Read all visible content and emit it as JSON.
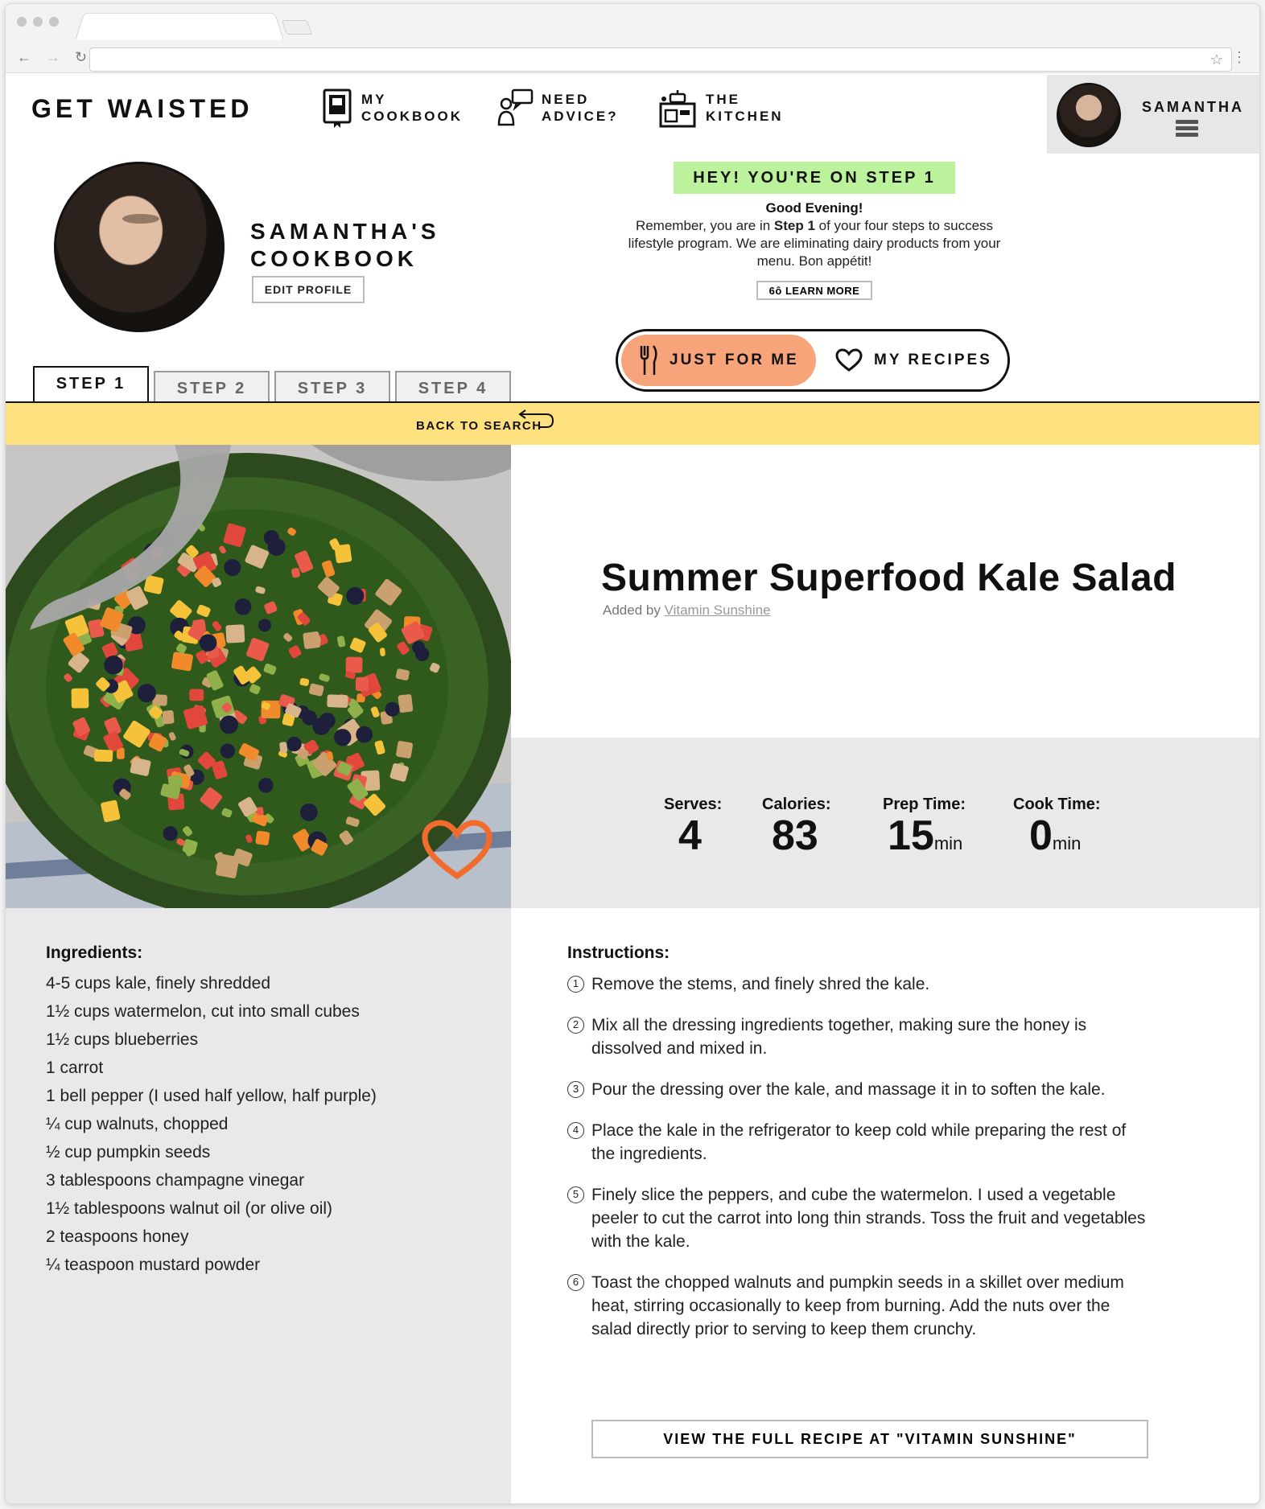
{
  "header": {
    "logo": "GET WAISTED",
    "nav": [
      {
        "line1": "MY",
        "line2": "COOKBOOK",
        "icon": "cookbook-icon"
      },
      {
        "line1": "NEED",
        "line2": "ADVICE?",
        "icon": "advice-icon"
      },
      {
        "line1": "THE",
        "line2": "KITCHEN",
        "icon": "kitchen-icon"
      }
    ],
    "user": {
      "name": "SAMANTHA"
    }
  },
  "profile": {
    "title_line1": "SAMANTHA'S",
    "title_line2": "COOKBOOK",
    "edit_label": "EDIT PROFILE"
  },
  "banner": {
    "step_text": "HEY! YOU'RE ON STEP 1",
    "greeting": "Good Evening!",
    "msg_before": "Remember, you are in ",
    "msg_bold": "Step 1",
    "msg_after": " of your four steps to success lifestyle program. We are eliminating dairy products from your menu. Bon appétit!",
    "learn_more": "LEARN MORE"
  },
  "toggle": {
    "left_label": "JUST FOR ME",
    "right_label": "MY RECIPES"
  },
  "steps": [
    "STEP 1",
    "STEP 2",
    "STEP 3",
    "STEP 4"
  ],
  "back_label": "BACK TO SEARCH",
  "recipe": {
    "title": "Summer Superfood Kale Salad",
    "added_prefix": "Added by ",
    "author": "Vitamin Sunshine",
    "stats": [
      {
        "label": "Serves:",
        "value": "4",
        "unit": ""
      },
      {
        "label": "Calories:",
        "value": "83",
        "unit": ""
      },
      {
        "label": "Prep Time:",
        "value": "15",
        "unit": "min"
      },
      {
        "label": "Cook Time:",
        "value": "0",
        "unit": "min"
      }
    ],
    "ingredients_title": "Ingredients:",
    "ingredients": [
      "4-5 cups kale, finely shredded",
      "1½ cups watermelon, cut into small cubes",
      "1½ cups blueberries",
      "1 carrot",
      "1 bell pepper (I used half yellow, half purple)",
      "¼ cup walnuts, chopped",
      "½ cup pumpkin seeds",
      "3 tablespoons champagne vinegar",
      "1½ tablespoons walnut oil (or olive oil)",
      "2 teaspoons honey",
      "¼ teaspoon mustard powder"
    ],
    "instructions_title": "Instructions:",
    "instructions": [
      {
        "num": "1",
        "text": "Remove the stems, and finely shred the kale."
      },
      {
        "num": "2",
        "text": "Mix all the dressing ingredients together, making sure the honey is dissolved and mixed in."
      },
      {
        "num": "3",
        "text": "Pour the dressing over the kale, and massage it in to soften the kale."
      },
      {
        "num": "4",
        "text": "Place the kale in the refrigerator to keep cold while preparing the rest of the ingredients."
      },
      {
        "num": "5",
        "text": "Finely slice the peppers, and cube the watermelon. I used a vegetable peeler to cut the carrot into long thin strands. Toss the fruit and vegetables with the kale."
      },
      {
        "num": "6",
        "text": "Toast the chopped walnuts and pumpkin seeds in a skillet over medium heat, stirring occasionally to keep from burning. Add the nuts over the salad directly prior to serving to keep them crunchy."
      }
    ],
    "full_recipe_label": "VIEW THE FULL RECIPE AT \"VITAMIN SUNSHINE\""
  },
  "colors": {
    "accent_orange": "#f7a47b",
    "banner_yellow": "#fee07f",
    "step_green": "#bcf29b",
    "panel_gray": "#e9e9e9"
  }
}
